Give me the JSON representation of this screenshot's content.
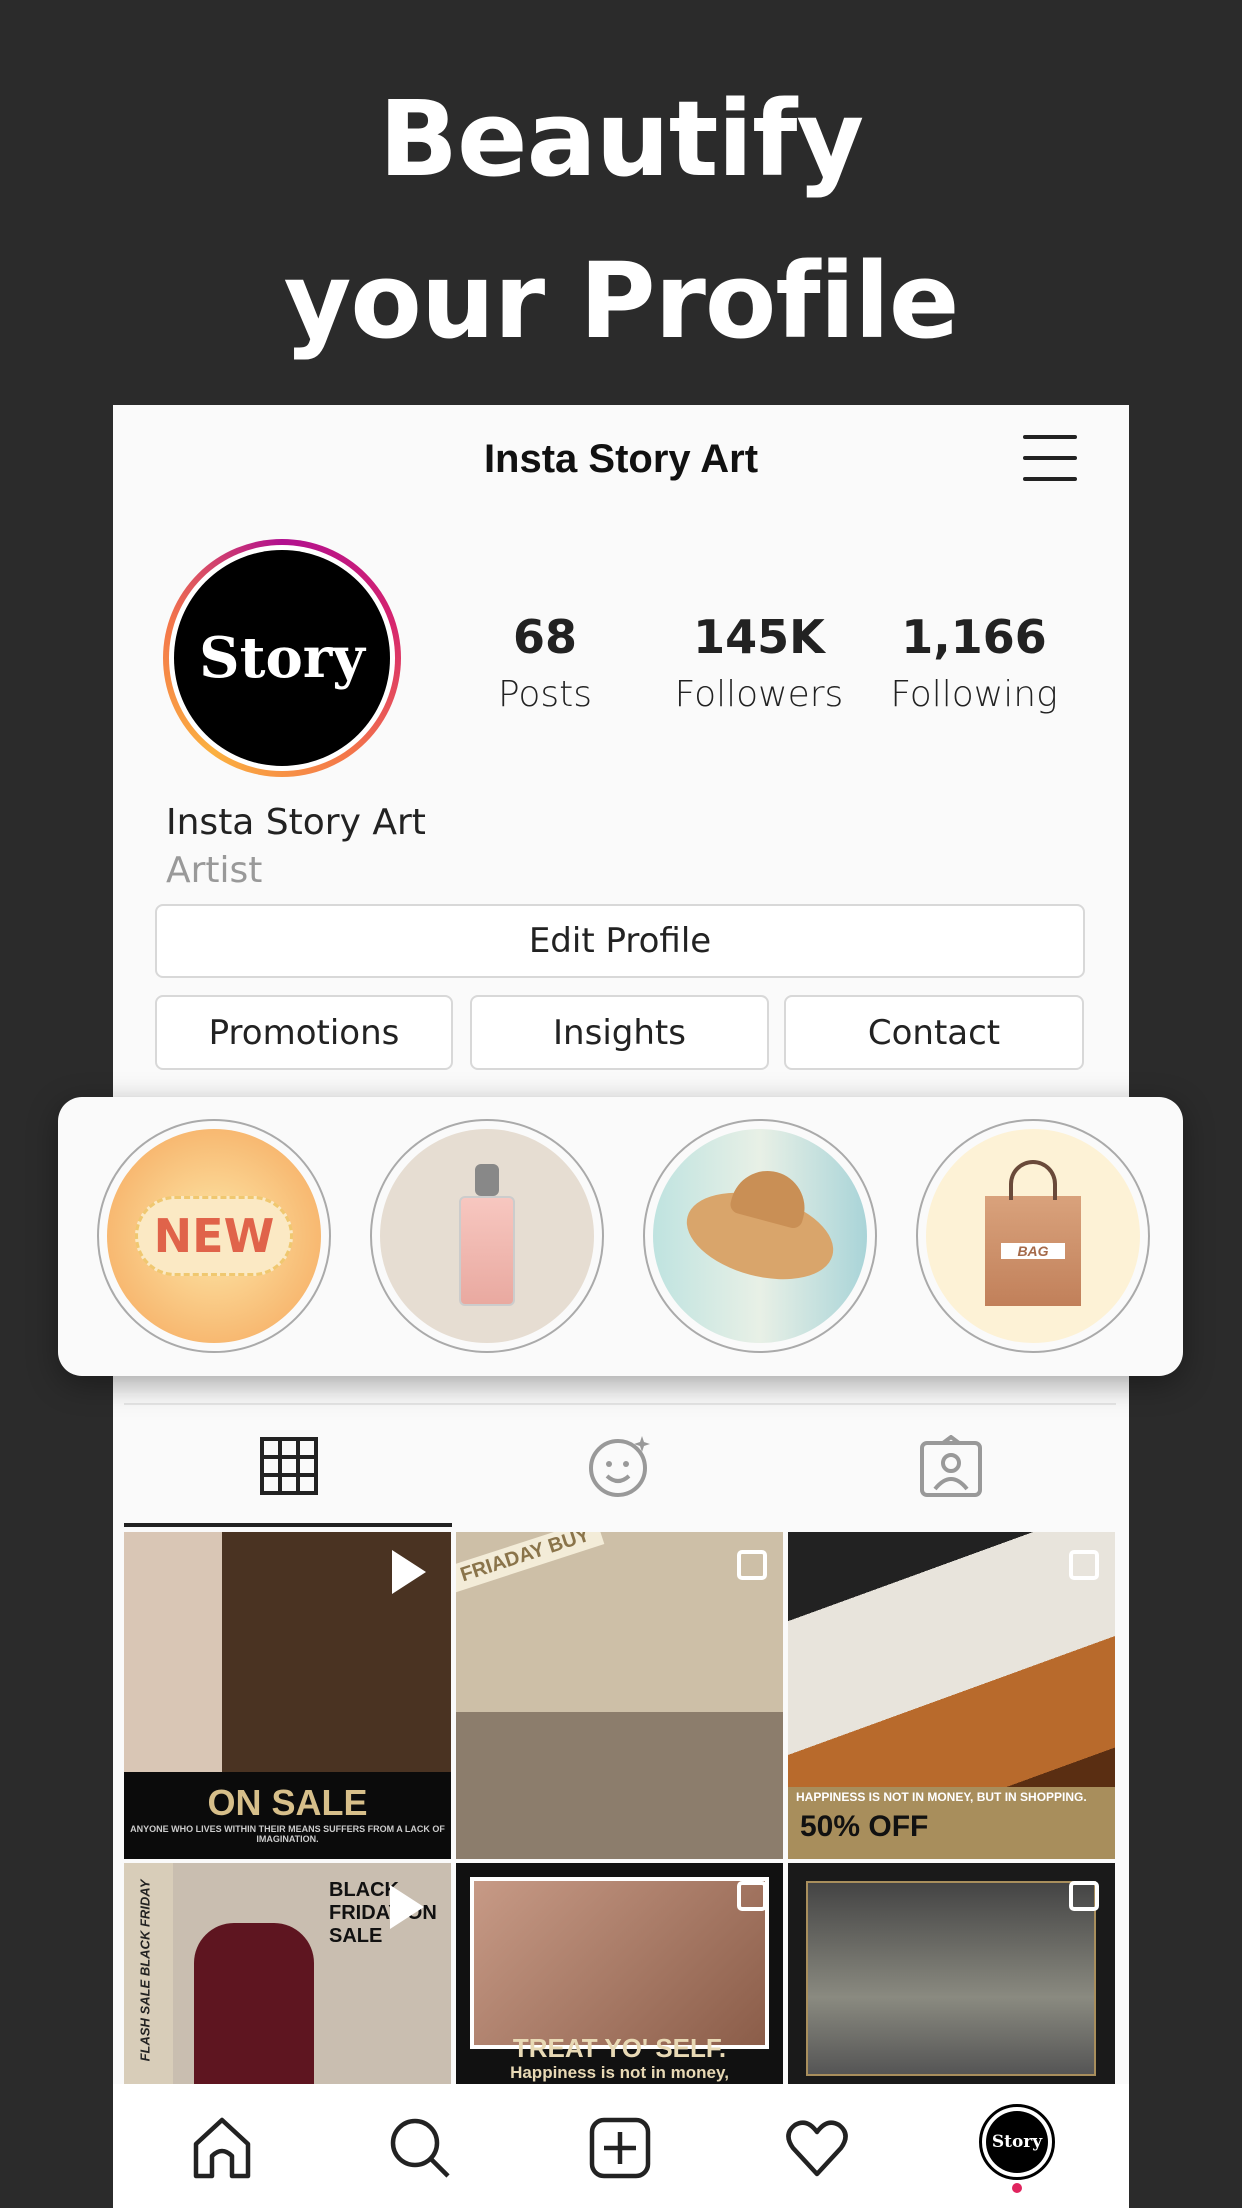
{
  "headline": {
    "line1": "Beautify",
    "line2": "your Profile"
  },
  "header": {
    "title": "Insta Story Art",
    "menu_icon": "hamburger-icon"
  },
  "profile": {
    "avatar_text": "Story",
    "name": "Insta Story Art",
    "bio": "Artist",
    "stats": [
      {
        "value": "68",
        "label": "Posts"
      },
      {
        "value": "145K",
        "label": "Followers"
      },
      {
        "value": "1,166",
        "label": "Following"
      }
    ]
  },
  "buttons": {
    "edit": "Edit Profile",
    "promotions": "Promotions",
    "insights": "Insights",
    "contact": "Contact"
  },
  "highlights": [
    {
      "label": "NEW"
    },
    {
      "label": "perfume"
    },
    {
      "label": "hat"
    },
    {
      "label": "BAG"
    }
  ],
  "tabs": [
    "grid-icon",
    "face-sparkle-icon",
    "tagged-person-icon"
  ],
  "posts": [
    {
      "caption": "ON SALE",
      "sub": "ANYONE WHO LIVES WITHIN THEIR MEANS SUFFERS FROM A LACK OF IMAGINATION.",
      "type": "video"
    },
    {
      "caption": "FRIADAY BUY",
      "sub": "",
      "type": "multi"
    },
    {
      "caption": "50% OFF",
      "sub": "HAPPINESS IS NOT IN MONEY, BUT IN SHOPPING.",
      "type": "multi"
    },
    {
      "caption": "BLACK FRIDAY ON SALE",
      "sub": "FLASH SALE BLACK FRIDAY",
      "type": "video"
    },
    {
      "caption": "TREAT YO' SELF.",
      "sub": "Happiness is not in money,",
      "type": "multi"
    },
    {
      "caption": "",
      "sub": "",
      "type": "multi"
    }
  ],
  "nav": {
    "items": [
      "home-icon",
      "search-icon",
      "add-post-icon",
      "heart-icon",
      "profile-avatar"
    ],
    "avatar_text": "Story",
    "accent": "#e0245e"
  }
}
